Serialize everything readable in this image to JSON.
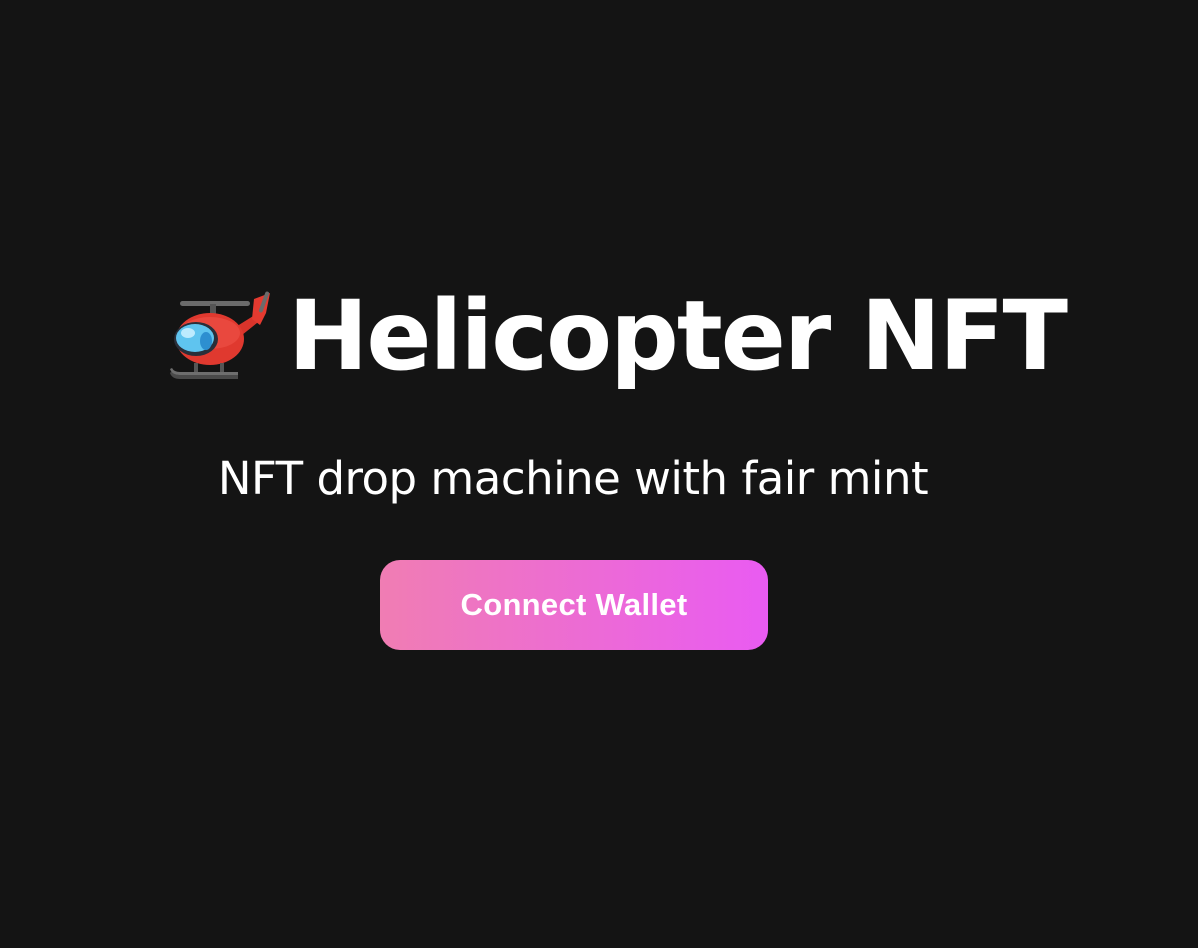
{
  "hero": {
    "icon": "helicopter-icon",
    "title": "Helicopter NFT"
  },
  "tagline": "NFT drop machine with fair mint",
  "connect_button": {
    "label": "Connect Wallet"
  },
  "colors": {
    "background": "#141414",
    "text": "#ffffff",
    "button_gradient_start": "#f07db3",
    "button_gradient_end": "#e95bf2"
  }
}
